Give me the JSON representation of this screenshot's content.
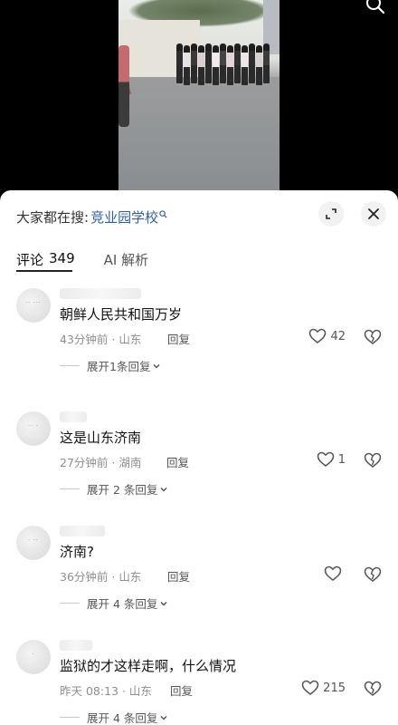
{
  "search": {
    "prefix": "大家都在搜:",
    "query": "竞业园学校"
  },
  "tabs": {
    "comments_label": "评论",
    "comments_count": "349",
    "ai_label": "AI 解析"
  },
  "comments": [
    {
      "text": "朝鲜人民共和国万岁",
      "meta": "43分钟前 · 山东",
      "reply_label": "回复",
      "likes": "42",
      "expand": "展开1条回复"
    },
    {
      "text": "这是山东济南",
      "meta": "27分钟前 · 湖南",
      "reply_label": "回复",
      "likes": "1",
      "expand": "展开 2 条回复"
    },
    {
      "text": "济南?",
      "meta": "36分钟前 · 山东",
      "reply_label": "回复",
      "likes": "",
      "expand": "展开 4 条回复"
    },
    {
      "text": "监狱的才这样走啊，什么情况",
      "meta": "昨天 08:13 · 山东",
      "reply_label": "回复",
      "likes": "215",
      "expand": "展开 4 条回复"
    }
  ],
  "icons": {
    "search": "search-icon",
    "collapse": "collapse-icon",
    "close": "close-icon",
    "heart": "heart-icon",
    "dislike": "broken-heart-icon",
    "chevron": "chevron-down-icon"
  },
  "colors": {
    "link": "#2f5fa7",
    "text": "#111111",
    "meta": "#8e8e8e",
    "sheet": "#ffffff"
  }
}
